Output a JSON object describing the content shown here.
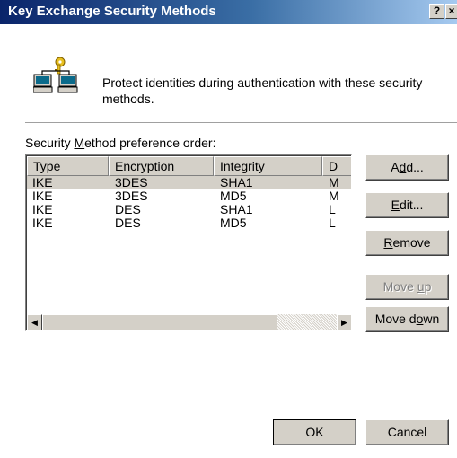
{
  "window": {
    "title": "Key Exchange Security Methods",
    "help_glyph": "?",
    "close_glyph": "×"
  },
  "description": "Protect identities during authentication with these security methods.",
  "list_label": {
    "before": "Security ",
    "mnemonic": "M",
    "after": "ethod preference order:"
  },
  "table": {
    "columns": [
      "Type",
      "Encryption",
      "Integrity",
      "D"
    ],
    "rows": [
      {
        "type": "IKE",
        "encryption": "3DES",
        "integrity": "SHA1",
        "d": "M",
        "selected": true
      },
      {
        "type": "IKE",
        "encryption": "3DES",
        "integrity": "MD5",
        "d": "M",
        "selected": false
      },
      {
        "type": "IKE",
        "encryption": "DES",
        "integrity": "SHA1",
        "d": "L",
        "selected": false
      },
      {
        "type": "IKE",
        "encryption": "DES",
        "integrity": "MD5",
        "d": "L",
        "selected": false
      }
    ]
  },
  "scrollbar": {
    "left_glyph": "◀",
    "right_glyph": "▶"
  },
  "buttons": {
    "add": {
      "before": "A",
      "mnemonic": "d",
      "after": "d..."
    },
    "edit": {
      "before": "",
      "mnemonic": "E",
      "after": "dit..."
    },
    "remove": {
      "before": "",
      "mnemonic": "R",
      "after": "emove"
    },
    "move_up": {
      "before": "Move ",
      "mnemonic": "u",
      "after": "p"
    },
    "move_down": {
      "before": "Move d",
      "mnemonic": "o",
      "after": "wn"
    },
    "ok": "OK",
    "cancel": "Cancel"
  },
  "icons": {
    "header_icon": "network-computers-key-icon"
  },
  "colors": {
    "title_bar_start": "#0a246a",
    "title_bar_end": "#a6caf0",
    "face": "#d4d0c8"
  }
}
